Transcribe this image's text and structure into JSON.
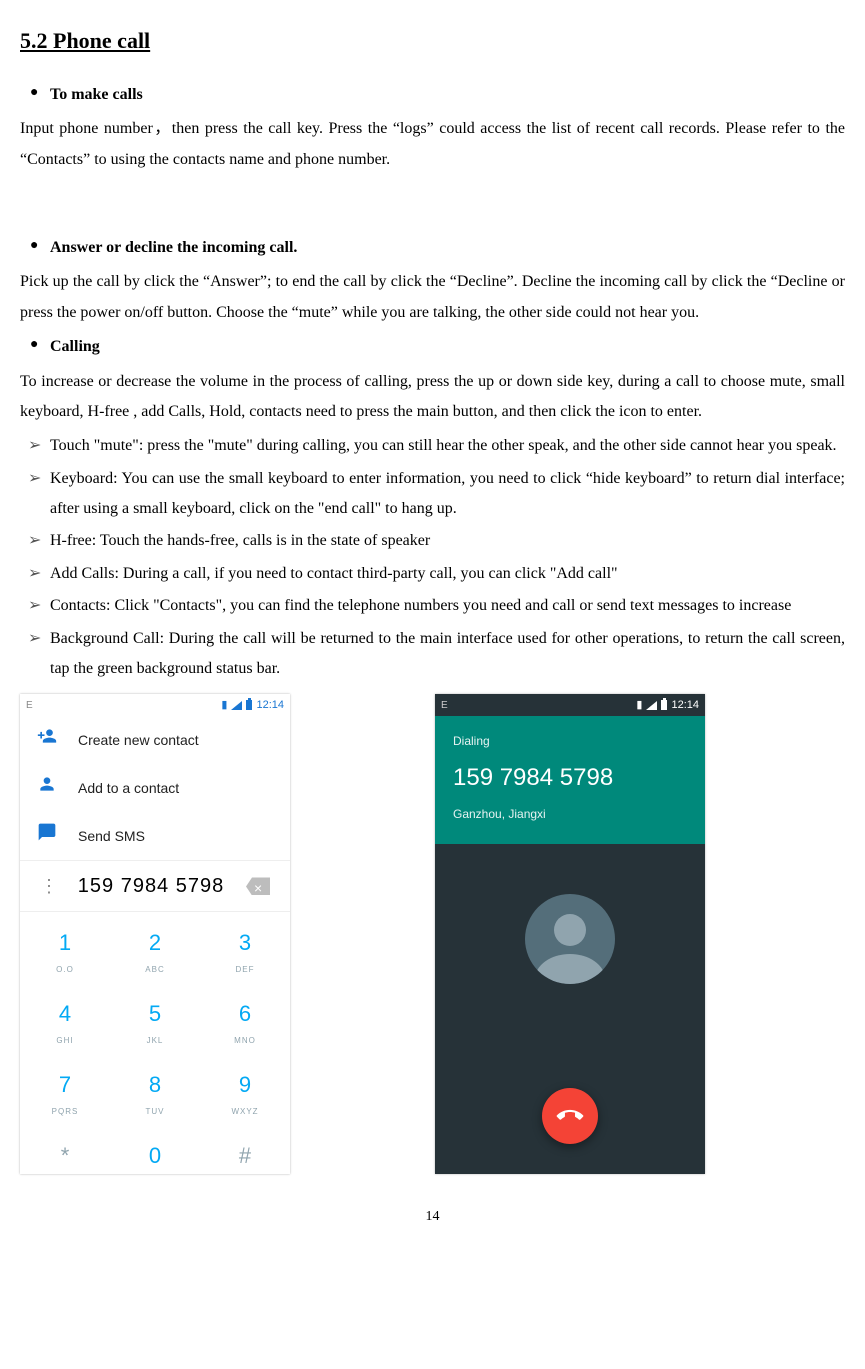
{
  "section_title": "5.2 Phone call",
  "bullets": {
    "b1_title": "To make calls",
    "b1_text": "Input phone number，then press the call key. Press the “logs” could access the list of recent call records. Please refer to the “Contacts” to using the contacts name and phone number.",
    "b2_title": "Answer or decline the incoming call.",
    "b2_text": "Pick up the call by click the “Answer”; to end the call by click the “Decline”. Decline the incoming call by click the “Decline or press the power on/off button. Choose the “mute” while you are talking, the other side could not hear you.",
    "b3_title": "Calling",
    "b3_text": "To increase or decrease the volume in the process of calling, press the up or down side key, during a call to choose mute, small keyboard, H-free , add Calls, Hold, contacts need to press the main button, and then click the icon to enter."
  },
  "arrows": [
    "Touch \"mute\": press the \"mute\" during calling, you can still hear the other speak, and the other side cannot hear you speak.",
    "Keyboard: You can use the small keyboard to enter information, you need to click “hide keyboard” to return dial interface; after using a small keyboard, click on the \"end call\" to hang up.",
    "H-free: Touch the hands-free, calls is in the state of speaker",
    "Add Calls: During a call, if you need to contact third-party call, you can click \"Add call\"",
    "Contacts: Click \"Contacts\", you can find the telephone numbers you need and call or send text messages to increase",
    "Background Call: During the call will be returned to the main interface used for other operations, to return the call screen, tap the green background status bar."
  ],
  "phone1": {
    "status_e": "E",
    "status_time": "12:14",
    "opt_create": "Create new contact",
    "opt_add": "Add to a contact",
    "opt_sms": "Send SMS",
    "number": "159 7984 5798",
    "keys": [
      {
        "d": "1",
        "l": "O.O"
      },
      {
        "d": "2",
        "l": "ABC"
      },
      {
        "d": "3",
        "l": "DEF"
      },
      {
        "d": "4",
        "l": "GHI"
      },
      {
        "d": "5",
        "l": "JKL"
      },
      {
        "d": "6",
        "l": "MNO"
      },
      {
        "d": "7",
        "l": "PQRS"
      },
      {
        "d": "8",
        "l": "TUV"
      },
      {
        "d": "9",
        "l": "WXYZ"
      },
      {
        "d": "*",
        "l": ""
      },
      {
        "d": "0",
        "l": "+"
      },
      {
        "d": "#",
        "l": ""
      }
    ]
  },
  "phone2": {
    "status_e": "E",
    "status_time": "12:14",
    "dialing": "Dialing",
    "number": "159 7984 5798",
    "location": "Ganzhou, Jiangxi"
  },
  "page_number": "14"
}
